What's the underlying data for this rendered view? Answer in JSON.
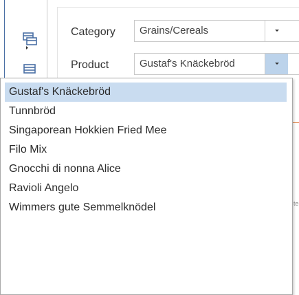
{
  "filter": {
    "category": {
      "label": "Category",
      "value": "Grains/Cereals"
    },
    "product": {
      "label": "Product",
      "value": "Gustaf's Knäckebröd"
    }
  },
  "dropdown": {
    "selected_index": 0,
    "options": [
      "Gustaf's Knäckebröd",
      "Tunnbröd",
      "Singaporean Hokkien Fried Mee",
      "Filo Mix",
      "Gnocchi di nonna Alice",
      "Ravioli Angelo",
      "Wimmers gute Semmelknödel"
    ]
  },
  "colors": {
    "selection": "#c9dcf0",
    "active_arrow": "#bcd3eb",
    "icon_blue": "#4a6fa5"
  },
  "icons": [
    "table-icon",
    "table-expand-icon"
  ]
}
